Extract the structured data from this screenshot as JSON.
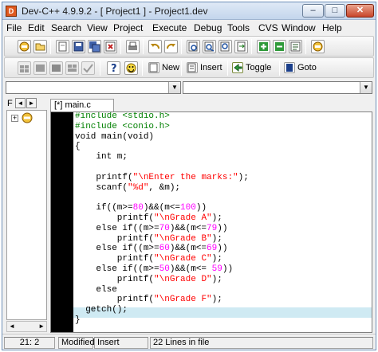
{
  "window": {
    "title": "Dev-C++ 4.9.9.2  - [ Project1 ] - Project1.dev",
    "controls": {
      "minimize": "–",
      "maximize": "□",
      "close": "✕"
    }
  },
  "menubar": [
    "File",
    "Edit",
    "Search",
    "View",
    "Project",
    "Execute",
    "Debug",
    "Tools",
    "CVS",
    "Window",
    "Help"
  ],
  "toolbar2": {
    "new_label": "New",
    "insert_label": "Insert",
    "toggle_label": "Toggle",
    "goto_label": "Goto"
  },
  "project_panel": {
    "tab_label": "F",
    "left_arrow": "◄",
    "right_arrow": "►",
    "expand": "+"
  },
  "editor": {
    "tab_label": "[*] main.c",
    "lines": [
      [
        {
          "t": "#include <stdio.h>",
          "c": "pp"
        }
      ],
      [
        {
          "t": "#include <conio.h>",
          "c": "pp"
        }
      ],
      [
        {
          "t": "void main(void)",
          "c": "kw"
        }
      ],
      [
        {
          "t": "{",
          "c": "kw"
        }
      ],
      [
        {
          "t": "    int m;",
          "c": "kw"
        }
      ],
      [],
      [
        {
          "t": "    printf(",
          "c": "kw"
        },
        {
          "t": "\"\\nEnter the marks:\"",
          "c": "st"
        },
        {
          "t": ");",
          "c": "kw"
        }
      ],
      [
        {
          "t": "    scanf(",
          "c": "kw"
        },
        {
          "t": "\"%d\"",
          "c": "st"
        },
        {
          "t": ", &m);",
          "c": "kw"
        }
      ],
      [],
      [
        {
          "t": "    if((m>=",
          "c": "kw"
        },
        {
          "t": "80",
          "c": "nu"
        },
        {
          "t": ")&&(m<=",
          "c": "kw"
        },
        {
          "t": "100",
          "c": "nu"
        },
        {
          "t": "))",
          "c": "kw"
        }
      ],
      [
        {
          "t": "        printf(",
          "c": "kw"
        },
        {
          "t": "\"\\nGrade A\"",
          "c": "st"
        },
        {
          "t": ");",
          "c": "kw"
        }
      ],
      [
        {
          "t": "    else if((m>=",
          "c": "kw"
        },
        {
          "t": "70",
          "c": "nu"
        },
        {
          "t": ")&&(m<=",
          "c": "kw"
        },
        {
          "t": "79",
          "c": "nu"
        },
        {
          "t": "))",
          "c": "kw"
        }
      ],
      [
        {
          "t": "        printf(",
          "c": "kw"
        },
        {
          "t": "\"\\nGrade B\"",
          "c": "st"
        },
        {
          "t": ");",
          "c": "kw"
        }
      ],
      [
        {
          "t": "    else if((m>=",
          "c": "kw"
        },
        {
          "t": "60",
          "c": "nu"
        },
        {
          "t": ")&&(m<=",
          "c": "kw"
        },
        {
          "t": "69",
          "c": "nu"
        },
        {
          "t": "))",
          "c": "kw"
        }
      ],
      [
        {
          "t": "        printf(",
          "c": "kw"
        },
        {
          "t": "\"\\nGrade C\"",
          "c": "st"
        },
        {
          "t": ");",
          "c": "kw"
        }
      ],
      [
        {
          "t": "    else if((m>=",
          "c": "kw"
        },
        {
          "t": "50",
          "c": "nu"
        },
        {
          "t": ")&&(m<= ",
          "c": "kw"
        },
        {
          "t": "59",
          "c": "nu"
        },
        {
          "t": "))",
          "c": "kw"
        }
      ],
      [
        {
          "t": "        printf(",
          "c": "kw"
        },
        {
          "t": "\"\\nGrade D\"",
          "c": "st"
        },
        {
          "t": ");",
          "c": "kw"
        }
      ],
      [
        {
          "t": "    else",
          "c": "kw"
        }
      ],
      [
        {
          "t": "        printf(",
          "c": "kw"
        },
        {
          "t": "\"\\nGrade F\"",
          "c": "st"
        },
        {
          "t": ");",
          "c": "kw"
        }
      ],
      [
        {
          "t": "  getch();",
          "c": "kw"
        }
      ],
      [
        {
          "t": "}",
          "c": "kw"
        }
      ]
    ]
  },
  "statusbar": {
    "position": "21: 2",
    "modified": "Modified",
    "mode": "Insert",
    "lines_info": "22 Lines in file"
  },
  "colors": {
    "preprocessor": "#008000",
    "string": "#ff0000",
    "number": "#ff00ff",
    "current_line": "#cfeaf3",
    "gutter": "#000000"
  }
}
